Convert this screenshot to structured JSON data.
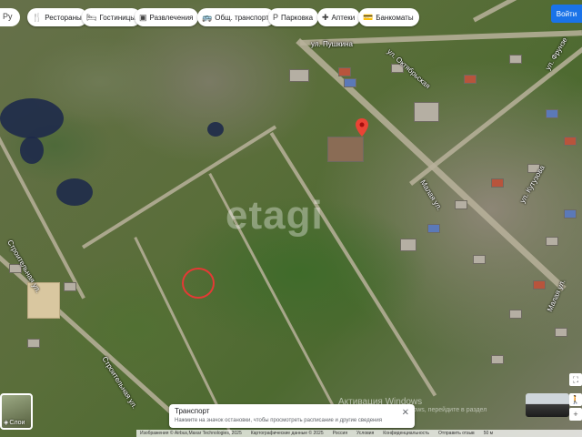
{
  "top_left_stub": "Pу",
  "chips": [
    {
      "label": "Рестораны",
      "icon": "🍴",
      "icon_name": "restaurant-icon"
    },
    {
      "label": "Гостиницы",
      "icon": "🛏",
      "icon_name": "hotel-icon"
    },
    {
      "label": "Развлечения",
      "icon": "▣",
      "icon_name": "entertainment-icon"
    },
    {
      "label": "Общ. транспорт",
      "icon": "🚌",
      "icon_name": "transit-icon"
    },
    {
      "label": "Парковка",
      "icon": "P",
      "icon_name": "parking-icon"
    },
    {
      "label": "Аптеки",
      "icon": "✚",
      "icon_name": "pharmacy-icon"
    },
    {
      "label": "Банкоматы",
      "icon": "💳",
      "icon_name": "atm-icon"
    }
  ],
  "signin_label": "Войти",
  "map_labels": {
    "top_street": "ул. Пушкина",
    "right_street_1": "ул. Октябрьская",
    "right_street_2": "ул. Фрунзе",
    "right_street_3": "ул. Кутузова",
    "middle_street": "Малая ул.",
    "left_street": "Строительная ул.",
    "bottom_left_street": "Строительная ул.",
    "bottom_right_street": "Малая ул."
  },
  "watermark": "etagi",
  "layers": {
    "label": "Слои"
  },
  "popup": {
    "title": "Транспорт",
    "text": "Нажмите на значок остановки, чтобы просмотреть расписание и другие сведения"
  },
  "windows_activation": {
    "title": "Активация Windows",
    "subtitle": "Чтобы активировать Windows, перейдите в раздел"
  },
  "attribution": {
    "imagery": "Изображения © Airbus,Maxar Technologies, 2025",
    "map_data": "Картографические данные © 2025",
    "links": [
      "Россия",
      "Условия",
      "Конфиденциальность",
      "Отправить отзыв"
    ],
    "scale": "50 м"
  }
}
